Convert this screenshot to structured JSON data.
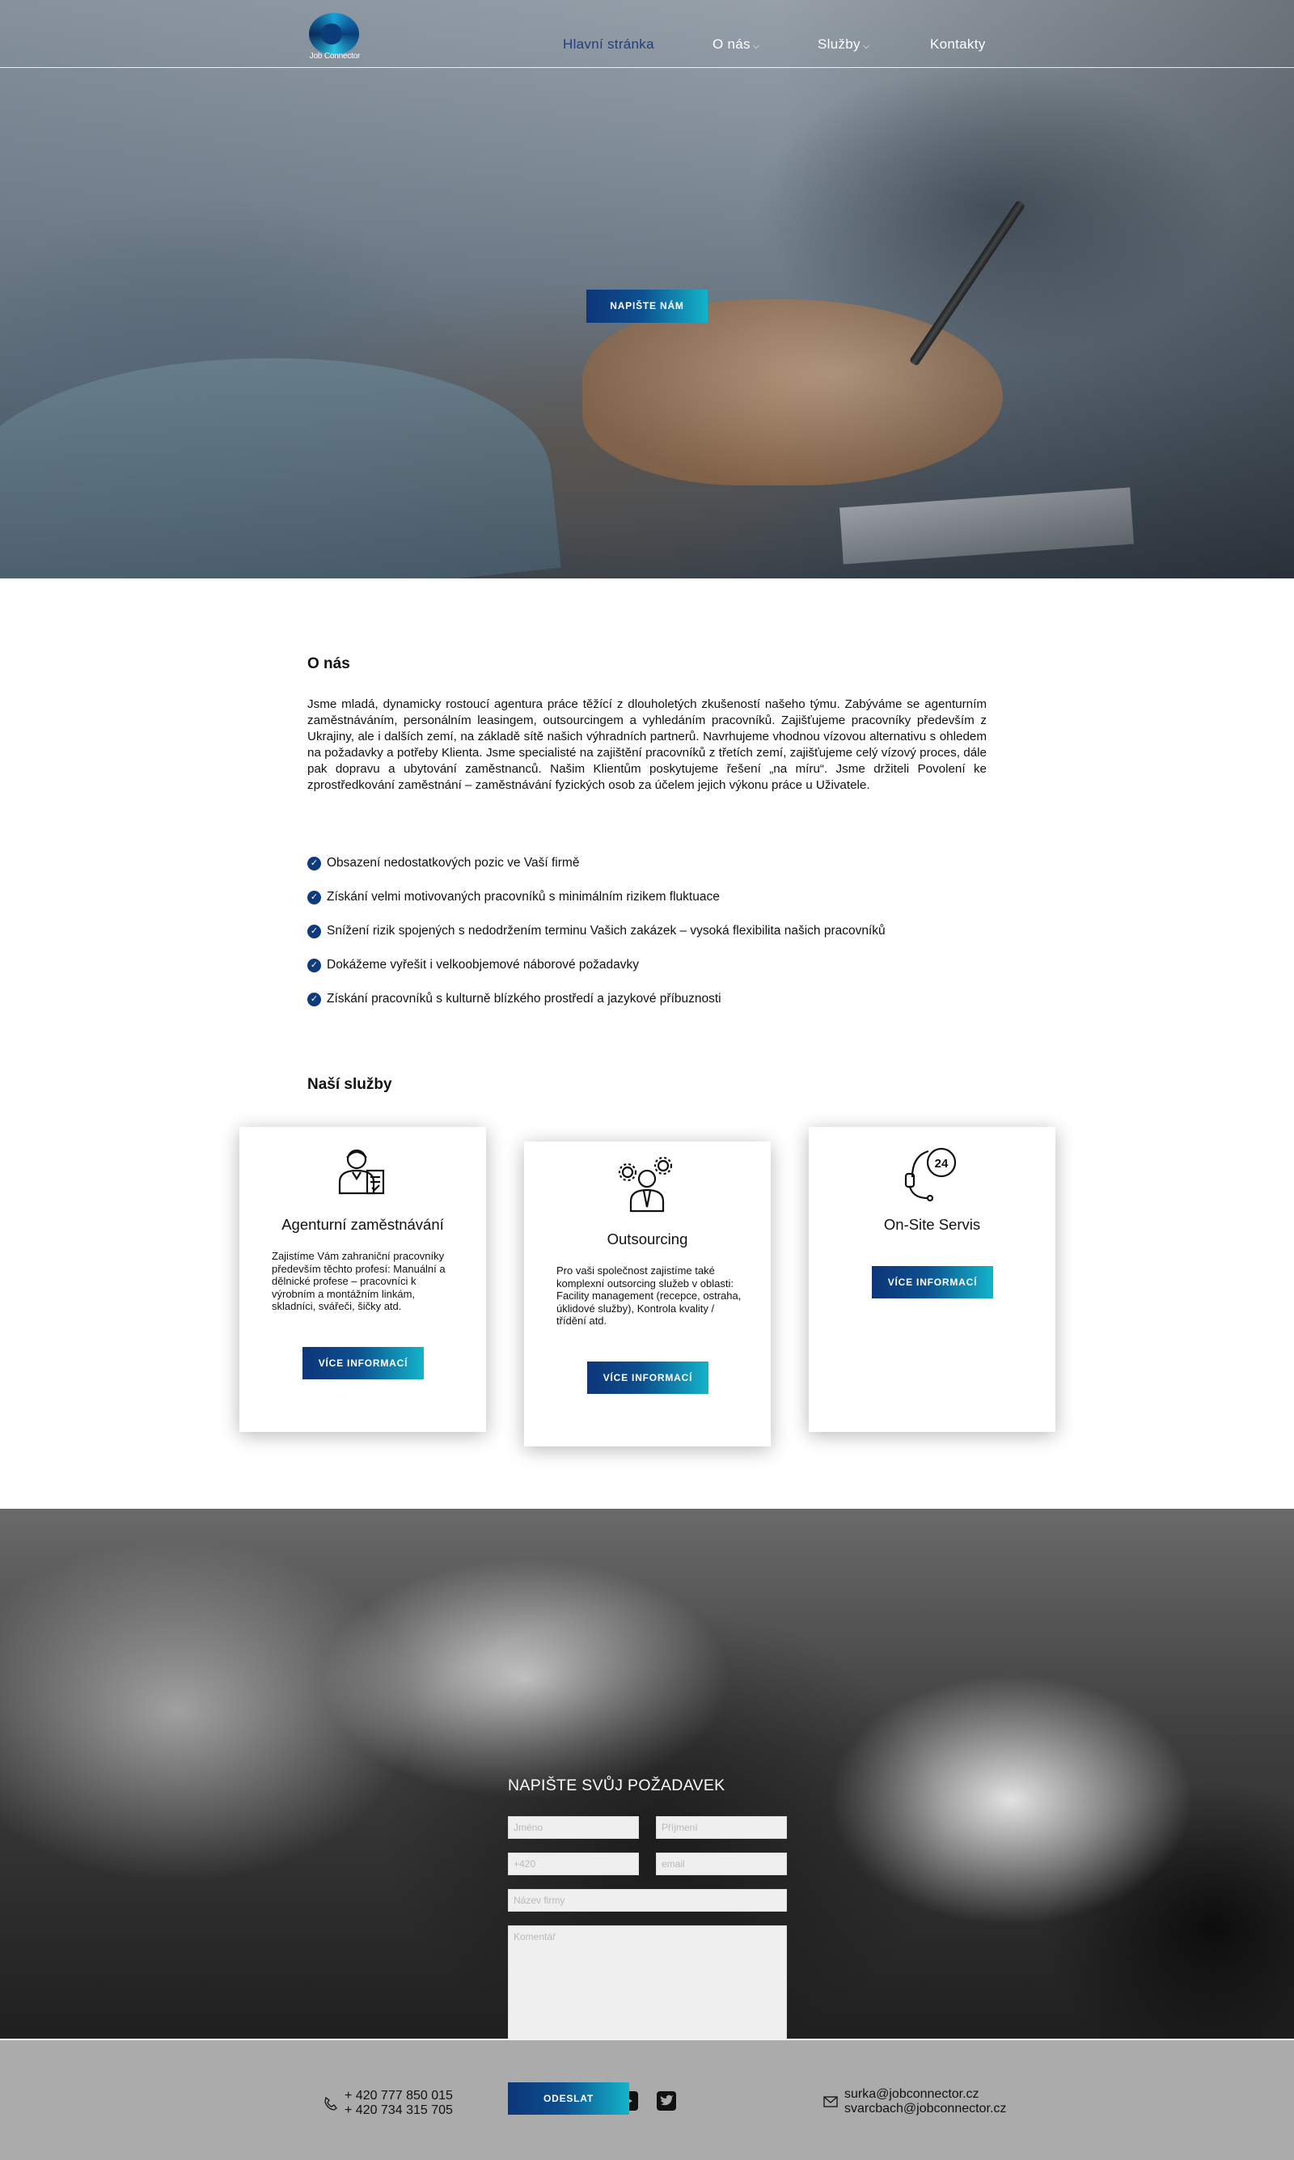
{
  "logo": {
    "text": "Job Connector"
  },
  "nav": {
    "items": [
      {
        "label": "Hlavní stránka",
        "active": true
      },
      {
        "label": "O nás",
        "dropdown": true
      },
      {
        "label": "Služby",
        "dropdown": true
      },
      {
        "label": "Kontakty"
      }
    ],
    "caret": "⌵"
  },
  "hero": {
    "button_label": "NAPIŠTE NÁM"
  },
  "about": {
    "title": "O nás",
    "text": "Jsme mladá, dynamicky rostoucí agentura práce těžící z dlouholetých zkušeností našeho týmu. Zabýváme se agenturním zaměstnáváním, personálním leasingem, outsourcingem a vyhledáním pracovníků. Zajišťujeme pracovníky především z Ukrajiny, ale i dalších zemí, na základě sítě našich výhradních partnerů. Navrhujeme vhodnou vízovou alternativu s ohledem na požadavky a potřeby Klienta. Jsme specialisté na zajištění pracovníků z třetích zemí, zajišťujeme celý vízový proces, dále pak dopravu a ubytování zaměstnanců. Našim Klientům poskytujeme řešení „na míru“. Jsme držiteli Povolení ke zprostředkování zaměstnání – zaměstnávání fyzických osob za účelem jejich výkonu práce u Uživatele.",
    "bullets": [
      "Obsazení nedostatkových pozic ve Vaší firmě",
      "Získání velmi motivovaných pracovníků s minimálním rizikem fluktuace",
      "Snížení rizik spojených s nedodržením terminu Vašich zakázek – vysoká flexibilita našich pracovníků",
      "Dokážeme vyřešit i velkoobjemové náborové požadavky",
      "Získání pracovníků s kulturně blízkého prostředí a jazykové příbuznosti"
    ]
  },
  "services": {
    "title": "Naší služby",
    "cards": [
      {
        "title": "Agenturní zaměstnávání",
        "icon": "worker-document-icon",
        "desc": "Zajistíme Vám zahraniční pracovníky především těchto profesí: Manuální a dělnické profese – pracovníci k výrobním a montážním linkám, skladníci, svářeči, šičky atd.",
        "button": "VÍCE INFORMACÍ"
      },
      {
        "title": "Outsourcing",
        "icon": "worker-gears-icon",
        "desc": "Pro vaši společnost zajistíme také komplexní outsorcing služeb v oblasti: Facility management (recepce, ostraha, úklidové služby), Kontrola kvality / třídění atd.",
        "button": "VÍCE INFORMACÍ"
      },
      {
        "title": "On-Site Servis",
        "icon": "headset-24-icon",
        "desc": "",
        "button": "VÍCE INFORMACÍ"
      }
    ]
  },
  "contact_form": {
    "title": "NAPIŠTE SVŮJ POŽADAVEK",
    "placeholders": {
      "first_name": "Jméno",
      "last_name": "Příjmení",
      "phone": "+420",
      "email": "email",
      "company": "Název firmy",
      "comment": "Komentář"
    },
    "submit": "ODESLAT"
  },
  "footer": {
    "phones": [
      "+ 420 777 850 015",
      "+ 420 734 315 705"
    ],
    "emails": [
      "surka@jobconnector.cz",
      "svarcbach@jobconnector.cz"
    ],
    "social": [
      "youtube-icon",
      "twitter-icon"
    ]
  },
  "colors": {
    "brand_dark": "#0d3679",
    "brand_light": "#13b4c9",
    "nav_active": "#233d7a",
    "footer_bg": "#ababab"
  }
}
